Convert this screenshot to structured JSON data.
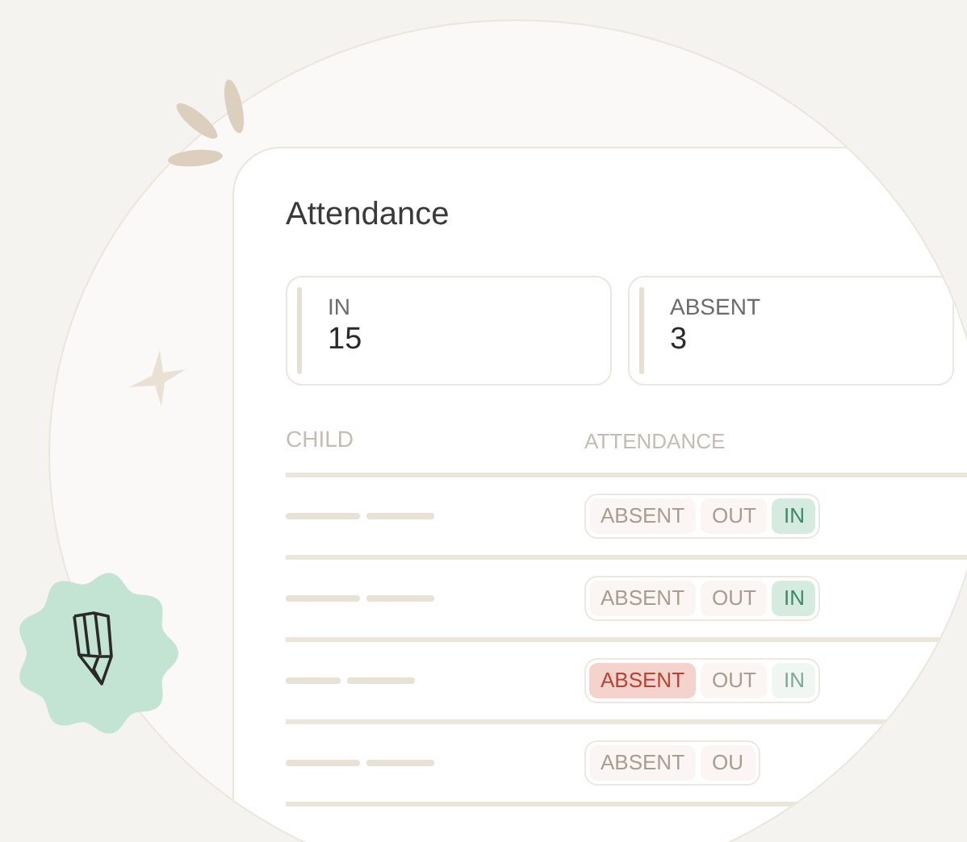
{
  "title": "Attendance",
  "stats": [
    {
      "label": "IN",
      "value": "15"
    },
    {
      "label": "ABSENT",
      "value": "3"
    }
  ],
  "table": {
    "columns": [
      "CHILD",
      "ATTENDANCE"
    ],
    "rows": [
      {
        "options": [
          {
            "kind": "absent",
            "label": "ABSENT",
            "selected": false
          },
          {
            "kind": "out",
            "label": "OUT",
            "selected": false
          },
          {
            "kind": "in",
            "label": "IN",
            "selected": true
          }
        ]
      },
      {
        "options": [
          {
            "kind": "absent",
            "label": "ABSENT",
            "selected": false
          },
          {
            "kind": "out",
            "label": "OUT",
            "selected": false
          },
          {
            "kind": "in",
            "label": "IN",
            "selected": true
          }
        ]
      },
      {
        "options": [
          {
            "kind": "absent",
            "label": "ABSENT",
            "selected": true
          },
          {
            "kind": "out",
            "label": "OUT",
            "selected": false
          },
          {
            "kind": "in",
            "label": "IN",
            "selected": false
          }
        ]
      },
      {
        "options": [
          {
            "kind": "absent",
            "label": "ABSENT",
            "selected": false
          },
          {
            "kind": "out",
            "label": "OU",
            "selected": false
          }
        ]
      }
    ]
  }
}
